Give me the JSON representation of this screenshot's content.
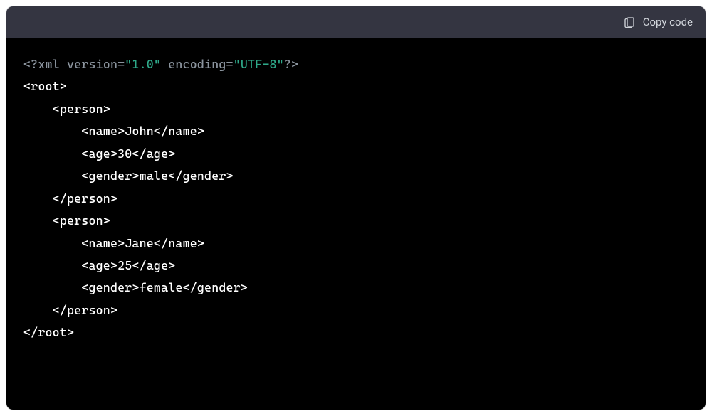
{
  "header": {
    "copy_label": "Copy code"
  },
  "code": {
    "xml_declaration": {
      "open": "<?xml",
      "version_attr": " version=",
      "version_val": "\"1.0\"",
      "encoding_attr": " encoding=",
      "encoding_val": "\"UTF-8\"",
      "close": "?>"
    },
    "tags": {
      "root_open": "<root>",
      "root_close": "</root>",
      "person_open": "<person>",
      "person_close": "</person>",
      "name_open": "<name>",
      "name_close": "</name>",
      "age_open": "<age>",
      "age_close": "</age>",
      "gender_open": "<gender>",
      "gender_close": "</gender>"
    },
    "persons": [
      {
        "name": "John",
        "age": "30",
        "gender": "male"
      },
      {
        "name": "Jane",
        "age": "25",
        "gender": "female"
      }
    ],
    "indent1": "    ",
    "indent2": "        "
  }
}
